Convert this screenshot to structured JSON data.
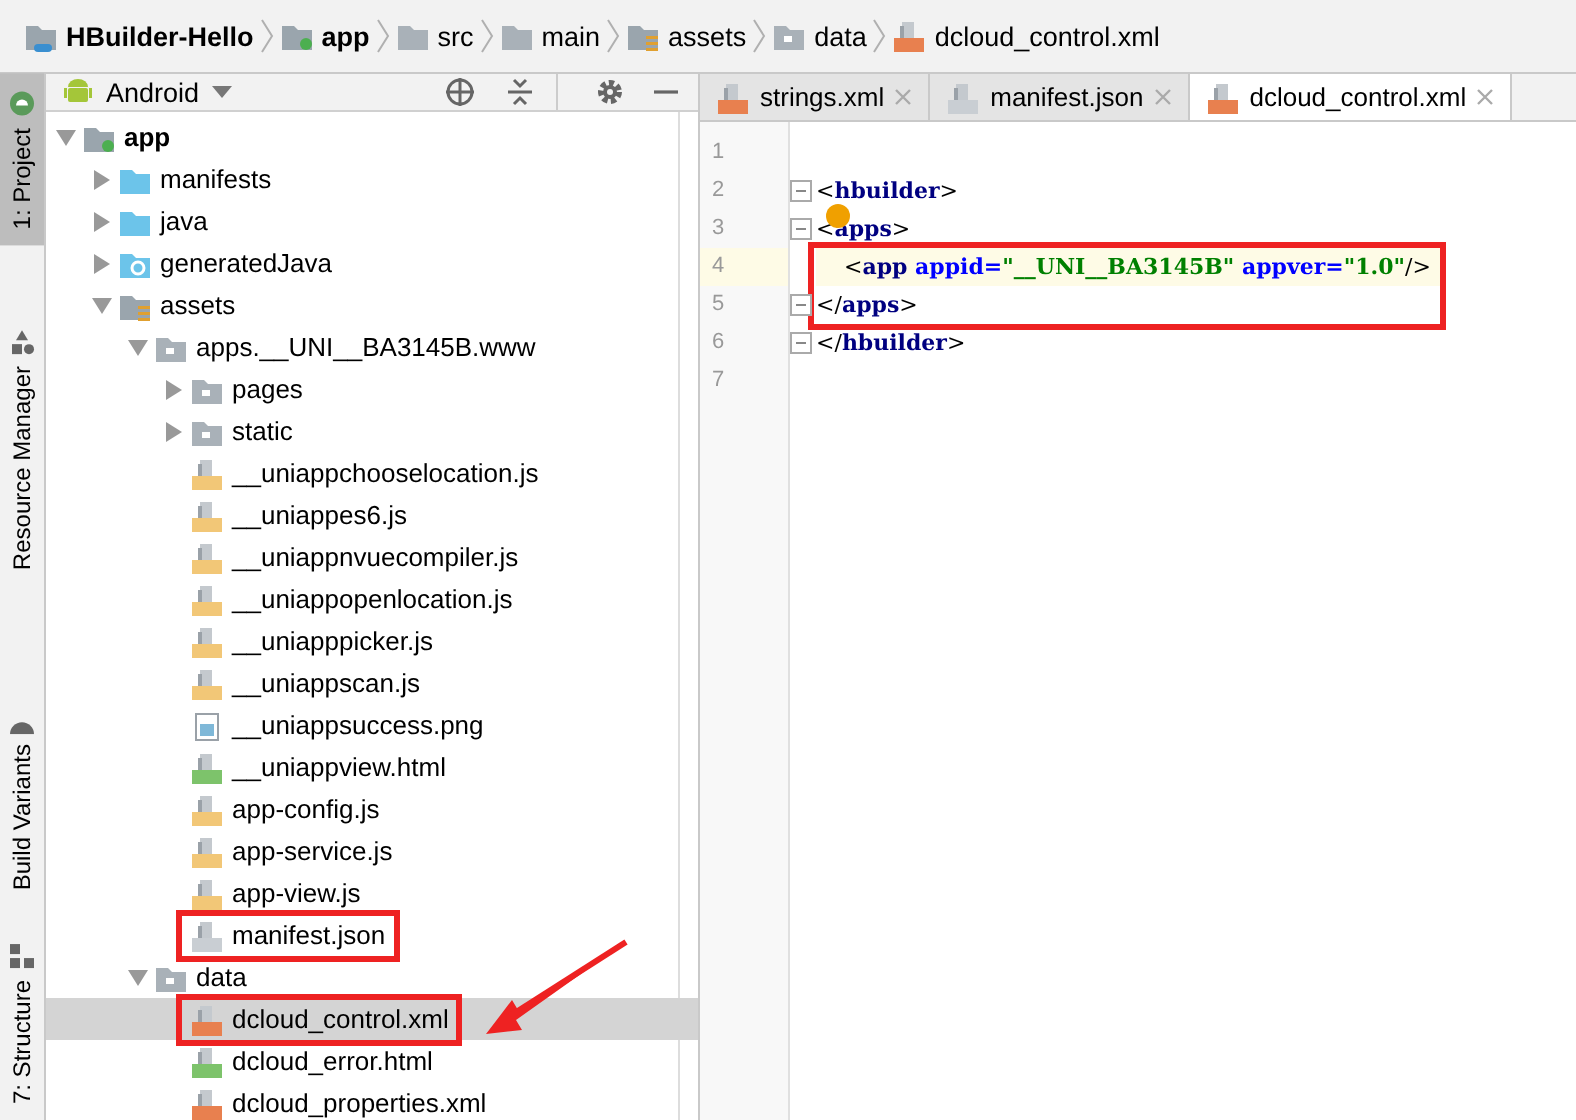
{
  "breadcrumbs": [
    {
      "kind": "project",
      "label": "HBuilder-Hello"
    },
    {
      "kind": "module",
      "label": "app"
    },
    {
      "kind": "folder",
      "label": "src"
    },
    {
      "kind": "folder",
      "label": "main"
    },
    {
      "kind": "assets",
      "label": "assets"
    },
    {
      "kind": "gray",
      "label": "data"
    },
    {
      "kind": "xml",
      "label": "dcloud_control.xml"
    }
  ],
  "side_tabs": [
    {
      "label": "1: Project",
      "selected": true,
      "kind": "project"
    },
    {
      "label": "Resource Manager",
      "selected": false,
      "kind": "resources"
    },
    {
      "label": "Build Variants",
      "selected": false,
      "kind": "variants"
    },
    {
      "label": "7: Structure",
      "selected": false,
      "kind": "structure"
    }
  ],
  "project_panel": {
    "view": "Android",
    "tree": [
      {
        "label": "app",
        "kind": "module",
        "expanded": true,
        "selected": false,
        "children": [
          {
            "label": "manifests",
            "kind": "blue",
            "expanded": false,
            "selected": false
          },
          {
            "label": "java",
            "kind": "blue",
            "expanded": false,
            "selected": false
          },
          {
            "label": "generatedJava",
            "kind": "generated",
            "expanded": false,
            "selected": false
          },
          {
            "label": "assets",
            "kind": "assets",
            "expanded": true,
            "selected": false,
            "children": [
              {
                "label": "apps.__UNI__BA3145B.www",
                "kind": "gray",
                "expanded": true,
                "selected": false,
                "children": [
                  {
                    "label": "pages",
                    "kind": "gray",
                    "expanded": false,
                    "selected": false
                  },
                  {
                    "label": "static",
                    "kind": "gray",
                    "expanded": false,
                    "selected": false
                  },
                  {
                    "label": "__uniappchooselocation.js",
                    "kind": "js",
                    "selected": false
                  },
                  {
                    "label": "__uniappes6.js",
                    "kind": "js",
                    "selected": false
                  },
                  {
                    "label": "__uniappnvuecompiler.js",
                    "kind": "js",
                    "selected": false
                  },
                  {
                    "label": "__uniappopenlocation.js",
                    "kind": "js",
                    "selected": false
                  },
                  {
                    "label": "__uniapppicker.js",
                    "kind": "js",
                    "selected": false
                  },
                  {
                    "label": "__uniappscan.js",
                    "kind": "js",
                    "selected": false
                  },
                  {
                    "label": "__uniappsuccess.png",
                    "kind": "png",
                    "selected": false
                  },
                  {
                    "label": "__uniappview.html",
                    "kind": "html",
                    "selected": false
                  },
                  {
                    "label": "app-config.js",
                    "kind": "js",
                    "selected": false
                  },
                  {
                    "label": "app-service.js",
                    "kind": "js",
                    "selected": false
                  },
                  {
                    "label": "app-view.js",
                    "kind": "js",
                    "selected": false
                  },
                  {
                    "label": "manifest.json",
                    "kind": "json",
                    "selected": false,
                    "annotated": true
                  }
                ]
              },
              {
                "label": "data",
                "kind": "gray",
                "expanded": true,
                "selected": false,
                "children": [
                  {
                    "label": "dcloud_control.xml",
                    "kind": "xml",
                    "selected": true,
                    "annotated": true,
                    "arrow": true
                  },
                  {
                    "label": "dcloud_error.html",
                    "kind": "html",
                    "selected": false
                  },
                  {
                    "label": "dcloud_properties.xml",
                    "kind": "xml",
                    "selected": false
                  }
                ]
              }
            ]
          }
        ]
      }
    ]
  },
  "editor": {
    "tabs": [
      {
        "label": "strings.xml",
        "kind": "xml",
        "selected": false
      },
      {
        "label": "manifest.json",
        "kind": "json",
        "selected": false
      },
      {
        "label": "dcloud_control.xml",
        "kind": "xml",
        "selected": true
      }
    ],
    "lines": [
      {
        "number": "1",
        "fold": false,
        "current": false,
        "annotated": false
      },
      {
        "number": "2",
        "fold": true,
        "current": false,
        "annotated": false,
        "tokens": [
          {
            "kind": "punct",
            "text": "<"
          },
          {
            "kind": "tag",
            "text": "hbuilder"
          },
          {
            "kind": "punct",
            "text": ">"
          }
        ]
      },
      {
        "number": "3",
        "fold": true,
        "current": false,
        "annotated": false,
        "bulb": true,
        "tokens": [
          {
            "kind": "punct",
            "text": "<"
          },
          {
            "kind": "tag",
            "text": "apps"
          },
          {
            "kind": "punct",
            "text": ">"
          }
        ]
      },
      {
        "number": "4",
        "fold": false,
        "current": true,
        "annotated": true,
        "tokens": [
          {
            "kind": "punct",
            "text": "    <"
          },
          {
            "kind": "tag",
            "text": "app"
          },
          {
            "kind": "attr",
            "text": " appid="
          },
          {
            "kind": "value",
            "text": "\"__UNI__BA3145B\""
          },
          {
            "kind": "attr",
            "text": " appver="
          },
          {
            "kind": "value",
            "text": "\"1.0\""
          },
          {
            "kind": "punct",
            "text": "/>"
          }
        ]
      },
      {
        "number": "5",
        "fold": true,
        "current": false,
        "annotated": true,
        "tokens": [
          {
            "kind": "punct",
            "text": "</"
          },
          {
            "kind": "tag",
            "text": "apps"
          },
          {
            "kind": "punct",
            "text": ">"
          }
        ]
      },
      {
        "number": "6",
        "fold": true,
        "current": false,
        "annotated": false,
        "tokens": [
          {
            "kind": "punct",
            "text": "</"
          },
          {
            "kind": "tag",
            "text": "hbuilder"
          },
          {
            "kind": "punct",
            "text": ">"
          }
        ]
      },
      {
        "number": "7",
        "fold": false,
        "current": false,
        "annotated": false
      }
    ]
  }
}
